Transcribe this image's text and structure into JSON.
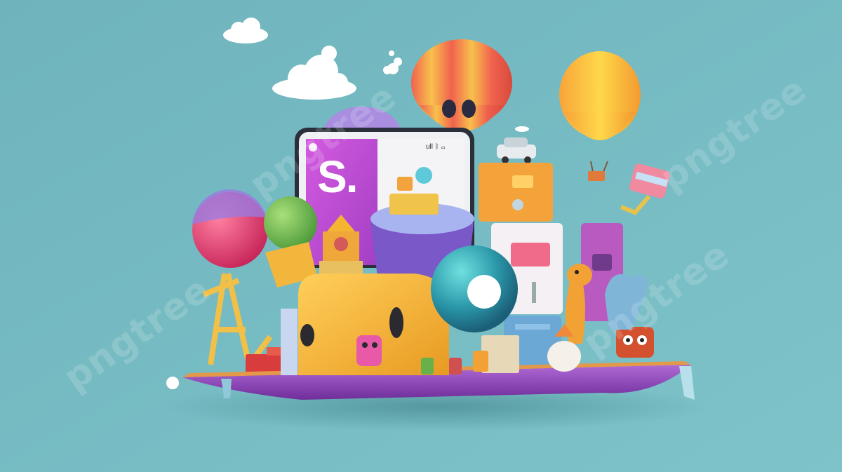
{
  "image": {
    "description_colors": {
      "background": "#72b7bf",
      "platform": "#9b4fc7",
      "screen_accent": "#c74fd6",
      "toy_yellow": "#f1b43a",
      "orb_teal": "#3aa6b0"
    }
  },
  "phone_screen": {
    "logo_text": "S.",
    "status_text": "ull ᛒ ▭"
  },
  "watermark": {
    "text": "pngtree"
  }
}
